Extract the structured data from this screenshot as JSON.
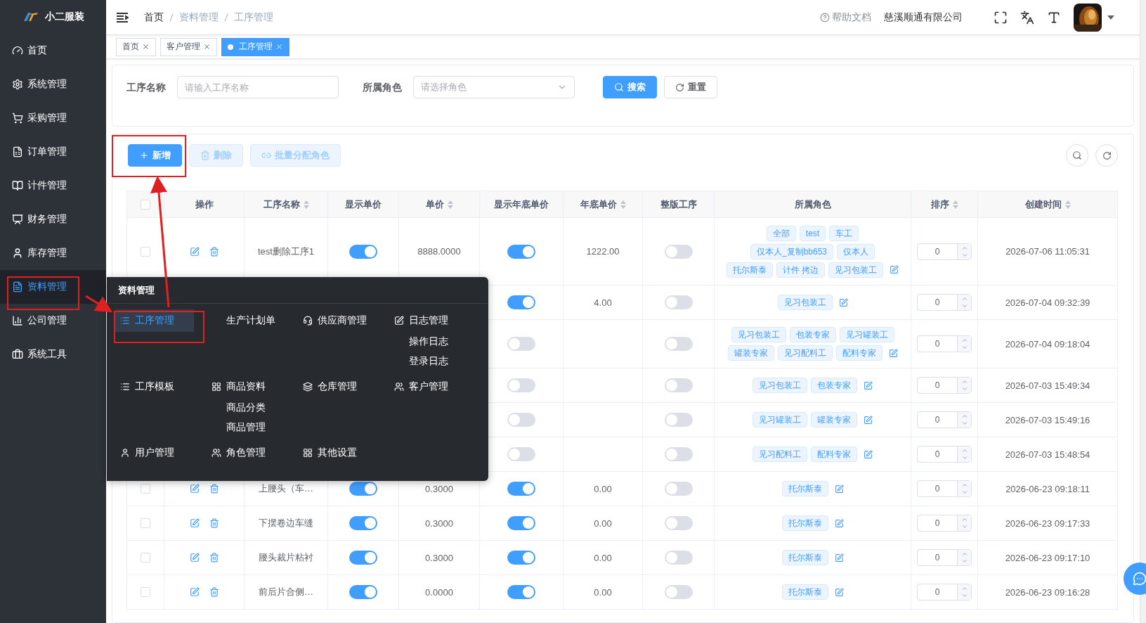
{
  "sidebar": {
    "logo": "小二服装",
    "items": [
      {
        "label": "首页",
        "selected": false
      },
      {
        "label": "系统管理",
        "selected": false
      },
      {
        "label": "采购管理",
        "selected": false
      },
      {
        "label": "订单管理",
        "selected": false
      },
      {
        "label": "计件管理",
        "selected": false
      },
      {
        "label": "财务管理",
        "selected": false
      },
      {
        "label": "库存管理",
        "selected": false
      },
      {
        "label": "资料管理",
        "selected": true
      },
      {
        "label": "公司管理",
        "selected": false
      },
      {
        "label": "系统工具",
        "selected": false
      }
    ]
  },
  "header": {
    "breadcrumb": [
      "首页",
      "资料管理",
      "工序管理"
    ],
    "help": "帮助文档",
    "company": "慈溪顺通有限公司"
  },
  "tabs": [
    {
      "label": "首页",
      "selected": false
    },
    {
      "label": "客户管理",
      "selected": false
    },
    {
      "label": "工序管理",
      "selected": true
    }
  ],
  "search": {
    "fields": [
      {
        "kind": "input",
        "label": "工序名称",
        "placeholder": "请输入工序名称"
      },
      {
        "kind": "select",
        "label": "所属角色",
        "placeholder": "请选择角色"
      }
    ],
    "buttons": [
      {
        "kind": "primary",
        "label": "搜索"
      },
      {
        "kind": "default",
        "label": "重置"
      }
    ]
  },
  "toolbar": {
    "buttons": [
      {
        "kind": "add",
        "label": "新增",
        "disabled": false
      },
      {
        "kind": "delete",
        "label": "删除",
        "disabled": true
      },
      {
        "kind": "assign",
        "label": "批量分配角色",
        "disabled": true
      }
    ]
  },
  "table": {
    "select_all_checked": false,
    "columns": [
      {
        "label": "操作",
        "sortable": false
      },
      {
        "label": "工序名称",
        "sortable": true
      },
      {
        "label": "显示单价",
        "sortable": false
      },
      {
        "label": "单价",
        "sortable": true
      },
      {
        "label": "显示年底单价",
        "sortable": false
      },
      {
        "label": "年底单价",
        "sortable": true
      },
      {
        "label": "整版工序",
        "sortable": false
      },
      {
        "label": "所属角色",
        "sortable": false
      },
      {
        "label": "排序",
        "sortable": true
      },
      {
        "label": "创建时间",
        "sortable": true
      }
    ],
    "rows": [
      {
        "checked": false,
        "name": "test删除工序1",
        "show_price": true,
        "price": "8888.0000",
        "show_year_price": true,
        "year_price": "1222.00",
        "whole": false,
        "role_lines": [
          [
            "全部",
            "test",
            "车工"
          ],
          [
            "仅本人_复制bb653",
            "仅本人"
          ],
          [
            "托尔斯泰",
            "计件 拷边",
            "见习包装工"
          ]
        ],
        "sort": "0",
        "created": "2026-07-06 11:05:31"
      },
      {
        "show_year_price": true,
        "year_price": "4.00",
        "whole": false,
        "role_lines": [
          [
            "见习包装工"
          ]
        ],
        "sort": "0",
        "created": "2026-07-04 09:32:39"
      },
      {
        "show_year_price": false,
        "whole": false,
        "role_lines": [
          [
            "见习包装工",
            "包装专家",
            "见习罐装工"
          ],
          [
            "罐装专家",
            "见习配料工",
            "配料专家"
          ]
        ],
        "sort": "0",
        "created": "2026-07-04 09:18:04"
      },
      {
        "show_year_price": false,
        "whole": false,
        "role_lines": [
          [
            "见习包装工",
            "包装专家"
          ]
        ],
        "sort": "0",
        "created": "2026-07-03 15:49:34"
      },
      {
        "show_year_price": false,
        "whole": false,
        "role_lines": [
          [
            "见习罐装工",
            "罐装专家"
          ]
        ],
        "sort": "0",
        "created": "2026-07-03 15:49:16"
      },
      {
        "show_year_price": false,
        "whole": false,
        "role_lines": [
          [
            "见习配料工",
            "配料专家"
          ]
        ],
        "sort": "0",
        "created": "2026-07-03 15:48:54"
      },
      {
        "checked": false,
        "name": "上腰头（车…",
        "show_price": true,
        "price": "0.3000",
        "show_year_price": true,
        "year_price": "0.00",
        "whole": false,
        "role_lines": [
          [
            "托尔斯泰"
          ]
        ],
        "sort": "0",
        "created": "2026-06-23 09:18:11"
      },
      {
        "checked": false,
        "name": "下摆卷边车缝",
        "show_price": true,
        "price": "0.3000",
        "show_year_price": true,
        "year_price": "0.00",
        "whole": false,
        "role_lines": [
          [
            "托尔斯泰"
          ]
        ],
        "sort": "0",
        "created": "2026-06-23 09:17:33"
      },
      {
        "checked": false,
        "name": "腰头裁片粘衬",
        "show_price": true,
        "price": "0.3000",
        "show_year_price": true,
        "year_price": "0.00",
        "whole": false,
        "role_lines": [
          [
            "托尔斯泰"
          ]
        ],
        "sort": "0",
        "created": "2026-06-23 09:17:10"
      },
      {
        "checked": false,
        "name": "前后片合侧…",
        "show_price": true,
        "price": "0.0000",
        "show_year_price": true,
        "year_price": "0.00",
        "whole": false,
        "role_lines": [
          [
            "托尔斯泰"
          ]
        ],
        "sort": "0",
        "created": "2026-06-23 09:16:28"
      }
    ]
  },
  "menu": {
    "title": "资料管理",
    "groups": [
      {
        "label": "工序管理",
        "selected": true
      },
      {
        "label": "生产计划单",
        "selected": false
      },
      {
        "label": "供应商管理",
        "selected": false
      },
      {
        "label": "日志管理",
        "selected": false,
        "children": [
          "操作日志",
          "登录日志"
        ]
      },
      {
        "label": "工序模板",
        "selected": false
      },
      {
        "label": "商品资料",
        "selected": false,
        "children": [
          "商品分类",
          "商品管理"
        ]
      },
      {
        "label": "仓库管理",
        "selected": false
      },
      {
        "label": "客户管理",
        "selected": false
      },
      {
        "label": "用户管理",
        "selected": false
      },
      {
        "label": "角色管理",
        "selected": false
      },
      {
        "label": "其他设置",
        "selected": false
      }
    ]
  }
}
